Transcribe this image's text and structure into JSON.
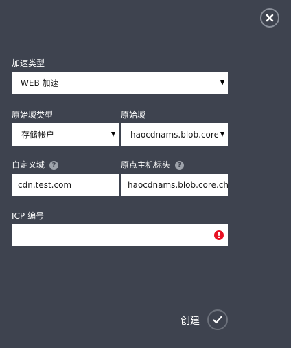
{
  "accel_type": {
    "label": "加速类型",
    "value": "WEB 加速"
  },
  "origin_type": {
    "label": "原始域类型",
    "value": "存储帐户"
  },
  "origin_domain": {
    "label": "原始域",
    "value": "haocdnams.blob.core.chinacloudapi.cn"
  },
  "custom_domain": {
    "label": "自定义域",
    "value": "cdn.test.com",
    "help_icon": "?"
  },
  "origin_host_header": {
    "label": "原点主机标头",
    "value": "haocdnams.blob.core.chinacloudapi.cn",
    "help_icon": "?"
  },
  "icp": {
    "label": "ICP 编号",
    "value": "",
    "error_icon": "!"
  },
  "footer": {
    "create_label": "创建"
  },
  "colors": {
    "background": "#3e434f",
    "error": "#e81123"
  },
  "icons": {
    "close": "close-icon",
    "check": "checkmark-icon"
  }
}
